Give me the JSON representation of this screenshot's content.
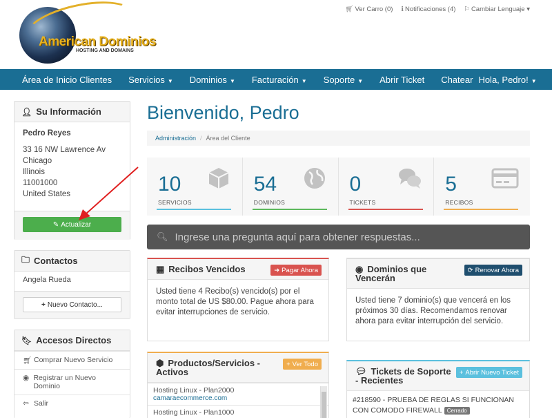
{
  "brand": {
    "logo_text": "American Dominios",
    "logo_subtitle": "HOSTING AND DOMAINS"
  },
  "top_links": {
    "cart": "Ver Carro (0)",
    "notifications": "Notificaciones (4)",
    "language": "Cambiar Lenguaje"
  },
  "nav": {
    "items": [
      {
        "label": "Área de Inicio Clientes",
        "dropdown": false
      },
      {
        "label": "Servicios",
        "dropdown": true
      },
      {
        "label": "Dominios",
        "dropdown": true
      },
      {
        "label": "Facturación",
        "dropdown": true
      },
      {
        "label": "Soporte",
        "dropdown": true
      },
      {
        "label": "Abrir Ticket",
        "dropdown": false
      },
      {
        "label": "Chatear",
        "dropdown": false
      }
    ],
    "user": "Hola, Pedro!"
  },
  "sidebar": {
    "info": {
      "title": "Su Información",
      "name": "Pedro Reyes",
      "address1": "33 16 NW Lawrence Av",
      "city": "Chicago",
      "state": "Illinois",
      "zip": "11001000",
      "country": "United States",
      "update_label": "Actualizar"
    },
    "contacts": {
      "title": "Contactos",
      "items": [
        "Angela Rueda"
      ],
      "new_contact_label": "Nuevo Contacto..."
    },
    "shortcuts": {
      "title": "Accesos Directos",
      "items": [
        {
          "label": "Comprar Nuevo Servicio",
          "icon": "cart-icon"
        },
        {
          "label": "Registrar un Nuevo Dominio",
          "icon": "globe-icon"
        },
        {
          "label": "Salir",
          "icon": "arrow-left-icon"
        }
      ]
    }
  },
  "main": {
    "welcome": "Bienvenido, Pedro",
    "breadcrumb": {
      "home": "Administración",
      "current": "Área del Cliente"
    },
    "stats": [
      {
        "value": "10",
        "label": "SERVICIOS",
        "color": "#5bc0de",
        "icon": "cube-icon"
      },
      {
        "value": "54",
        "label": "DOMINIOS",
        "color": "#5cb85c",
        "icon": "globe-icon"
      },
      {
        "value": "0",
        "label": "TICKETS",
        "color": "#d9534f",
        "icon": "comments-icon"
      },
      {
        "value": "5",
        "label": "RECIBOS",
        "color": "#f0ad4e",
        "icon": "credit-card-icon"
      }
    ],
    "search_placeholder": "Ingrese una pregunta aquí para obtener respuestas...",
    "recibos": {
      "title": "Recibos Vencidos",
      "button": "Pagar Ahora",
      "text": "Usted tiene 4 Recibo(s) vencido(s) por el monto total de US $80.00. Pague ahora para evitar interrupciones de servicio."
    },
    "dominios": {
      "title": "Dominios que Vencerán",
      "button": "Renovar Ahora",
      "text": "Usted tiene 7 dominio(s) que vencerá en los próximos 30 días. Recomendamos renovar ahora para evitar interrupción del servicio."
    },
    "productos": {
      "title": "Productos/Servicios - Activos",
      "button": "Ver Todo",
      "items": [
        {
          "name": "Hosting Linux - Plan2000",
          "domain": "camaraecommerce.com"
        },
        {
          "name": "Hosting Linux - Plan1000",
          "domain": ""
        }
      ]
    },
    "tickets": {
      "title": "Tickets de Soporte - Recientes",
      "button": "Abrir Nuevo Ticket",
      "items": [
        {
          "text": "#218590 - PRUEBA DE REGLAS SI FUNCIONAN CON COMODO FIREWALL",
          "status": "Cerrado"
        }
      ]
    }
  }
}
